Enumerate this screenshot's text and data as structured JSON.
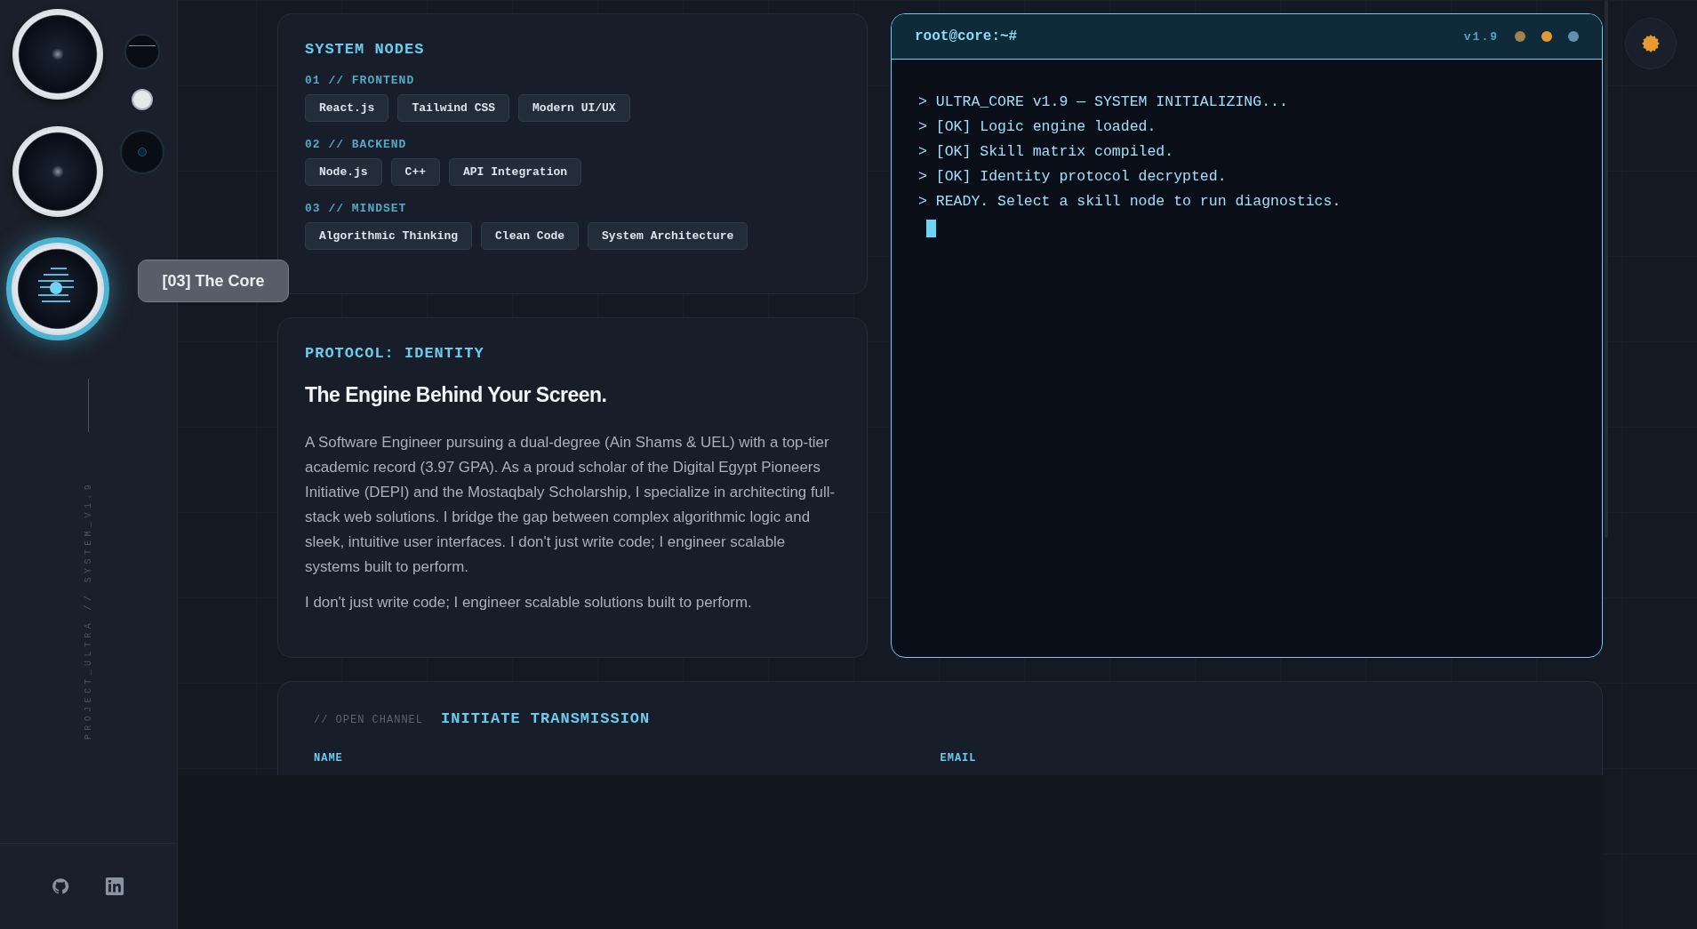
{
  "sidebar": {
    "lenses": [
      {
        "selected": false
      },
      {
        "selected": false
      },
      {
        "selected": true
      }
    ],
    "tooltip": "[03] The Core",
    "vertical_label": "PROJECT_ULTRA // SYSTEM_V1.9"
  },
  "skills": {
    "title": "SYSTEM NODES",
    "groups": [
      {
        "label": "01 // FRONTEND",
        "tags": [
          "React.js",
          "Tailwind CSS",
          "Modern UI/UX"
        ]
      },
      {
        "label": "02 // BACKEND",
        "tags": [
          "Node.js",
          "C++",
          "API Integration"
        ]
      },
      {
        "label": "03 // MINDSET",
        "tags": [
          "Algorithmic Thinking",
          "Clean Code",
          "System Architecture"
        ]
      }
    ]
  },
  "identity": {
    "kicker": "PROTOCOL: IDENTITY",
    "heading": "The Engine Behind Your Screen.",
    "paragraphs": [
      "A Software Engineer pursuing a dual-degree (Ain Shams & UEL) with a top-tier academic record (3.97 GPA). As a proud scholar of the Digital Egypt Pioneers Initiative (DEPI) and the Mostaqbaly Scholarship, I specialize in architecting full-stack web solutions. I bridge the gap between complex algorithmic logic and sleek, intuitive user interfaces. I don't just write code; I engineer scalable systems built to perform.",
      "I don't just write code; I engineer scalable solutions built to perform."
    ]
  },
  "terminal": {
    "prompt": "root@core:~#",
    "version": "v1.9",
    "lights": [
      {
        "color": "#a5804f"
      },
      {
        "color": "#e29a36"
      },
      {
        "color": "#5f93ad"
      }
    ],
    "lines": [
      "> ULTRA_CORE v1.9 — SYSTEM INITIALIZING...",
      "> [OK] Logic engine loaded.",
      "> [OK] Skill matrix compiled.",
      "> [OK] Identity protocol decrypted.",
      "> READY. Select a skill node to run diagnostics."
    ]
  },
  "contact": {
    "kicker": "// OPEN CHANNEL",
    "title": "INITIATE TRANSMISSION",
    "fields": [
      {
        "label": "NAME"
      },
      {
        "label": "EMAIL"
      }
    ]
  }
}
